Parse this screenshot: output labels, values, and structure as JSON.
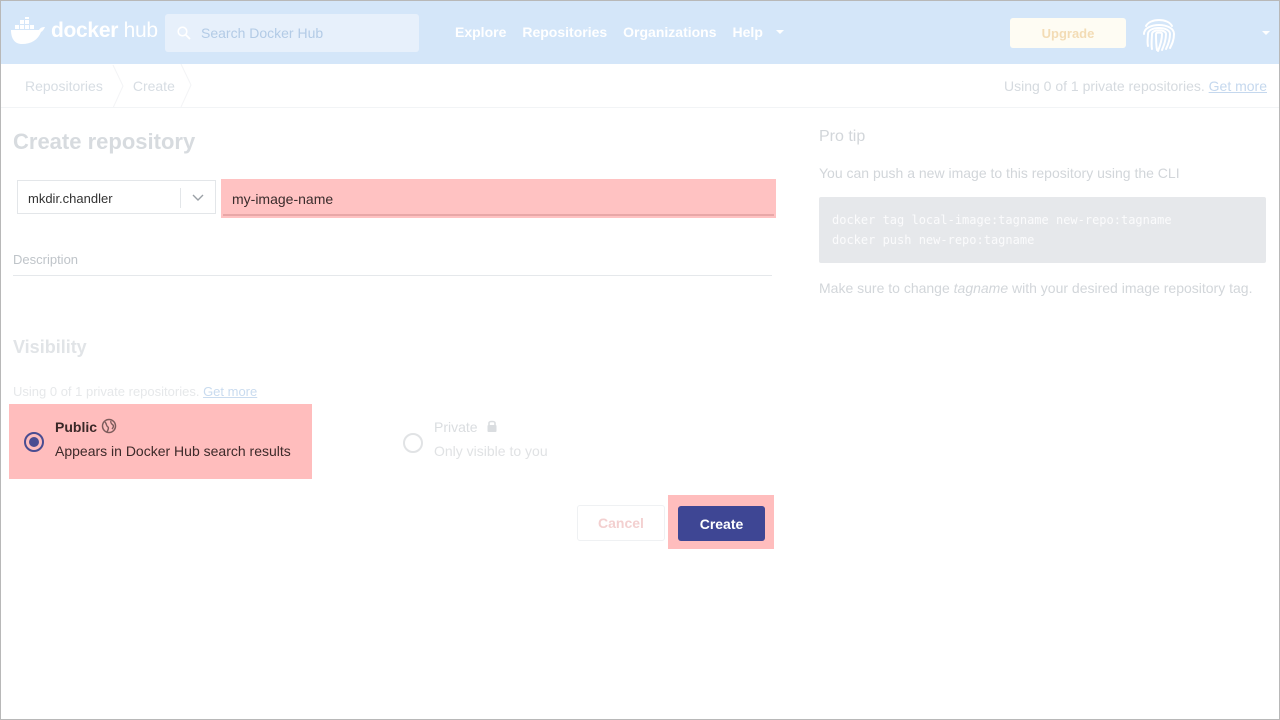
{
  "header": {
    "logo_text": "docker",
    "logo_text_suffix": "hub",
    "search_placeholder": "Search Docker Hub",
    "nav": [
      {
        "label": "Explore"
      },
      {
        "label": "Repositories"
      },
      {
        "label": "Organizations"
      },
      {
        "label": "Help"
      }
    ],
    "upgrade_label": "Upgrade"
  },
  "subheader": {
    "breadcrumbs": [
      "Repositories",
      "Create"
    ],
    "usage_text": "Using 0 of 1 private repositories.",
    "usage_link": "Get more"
  },
  "form": {
    "title": "Create repository",
    "namespace": "mkdir.chandler",
    "repo_name": "my-image-name",
    "description_label": "Description",
    "visibility_title": "Visibility",
    "visibility_usage_text": "Using 0 of 1 private repositories.",
    "visibility_usage_link": "Get more",
    "public": {
      "label": "Public",
      "description": "Appears in Docker Hub search results",
      "selected": true
    },
    "private": {
      "label": "Private",
      "description": "Only visible to you",
      "selected": false
    },
    "cancel_label": "Cancel",
    "create_label": "Create"
  },
  "protip": {
    "title": "Pro tip",
    "text": "You can push a new image to this repository using the CLI",
    "code_lines": [
      "docker tag local-image:tagname new-repo:tagname",
      "docker push new-repo:tagname"
    ],
    "note_before": "Make sure to change ",
    "note_em": "tagname",
    "note_after": " with your desired image repository tag."
  },
  "colors": {
    "nav_bg": "#d4e6f9",
    "highlight": "#ffbdbd",
    "primary_button": "#3e4694",
    "radio_selected": "#4a4c91"
  },
  "icons": [
    "docker-whale-icon",
    "search-icon",
    "chevron-down-icon",
    "fingerprint-avatar-icon",
    "globe-icon",
    "lock-icon"
  ]
}
